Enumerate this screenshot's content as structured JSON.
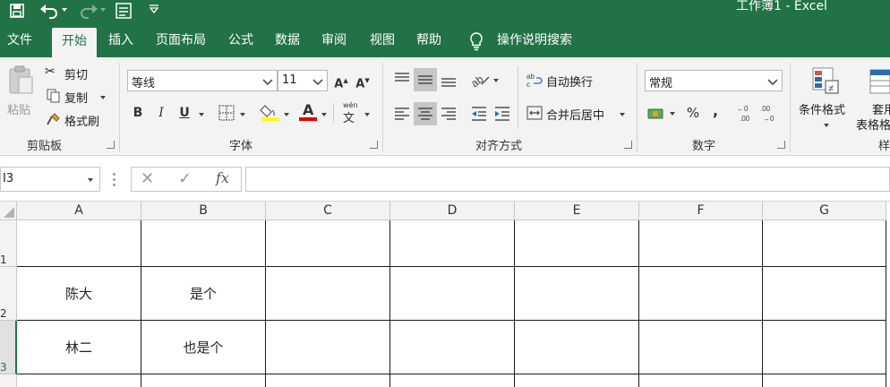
{
  "titlebar": {
    "title": "工作簿1  -  Excel",
    "icons": [
      "save-icon",
      "undo-icon",
      "redo-icon",
      "form-icon",
      "customize-qat-icon"
    ]
  },
  "tabs": [
    {
      "label": "文件",
      "active": false
    },
    {
      "label": "开始",
      "active": true
    },
    {
      "label": "插入",
      "active": false
    },
    {
      "label": "页面布局",
      "active": false
    },
    {
      "label": "公式",
      "active": false
    },
    {
      "label": "数据",
      "active": false
    },
    {
      "label": "审阅",
      "active": false
    },
    {
      "label": "视图",
      "active": false
    },
    {
      "label": "帮助",
      "active": false
    }
  ],
  "tellme": {
    "label": "操作说明搜索"
  },
  "ribbon": {
    "clipboard": {
      "paste": "粘贴",
      "cut": "剪切",
      "copy": "复制",
      "format_painter": "格式刷",
      "label": "剪贴板"
    },
    "font": {
      "font_name": "等线",
      "font_size": "11",
      "bold": "B",
      "italic": "I",
      "underline": "U",
      "label": "字体"
    },
    "alignment": {
      "wrap_text": "自动换行",
      "merge_center": "合并后居中",
      "label": "对齐方式"
    },
    "number": {
      "format": "常规",
      "percent": "%",
      "comma": ",",
      "label": "数字"
    },
    "styles": {
      "conditional": "条件格式",
      "table_a": "套用",
      "table_b": "表格格",
      "label": "样"
    }
  },
  "formula_bar": {
    "name_box": "I3",
    "cancel": "✕",
    "enter": "✓",
    "fx": "fx",
    "content": ""
  },
  "sheet": {
    "columns": [
      "A",
      "B",
      "C",
      "D",
      "E",
      "F",
      "G"
    ],
    "rows": [
      "1",
      "2",
      "3"
    ],
    "cells": {
      "A2": "陈大",
      "B2": "是个",
      "A3": "林二",
      "B3": "也是个"
    },
    "selected_row": "3",
    "accent": "#217346"
  }
}
